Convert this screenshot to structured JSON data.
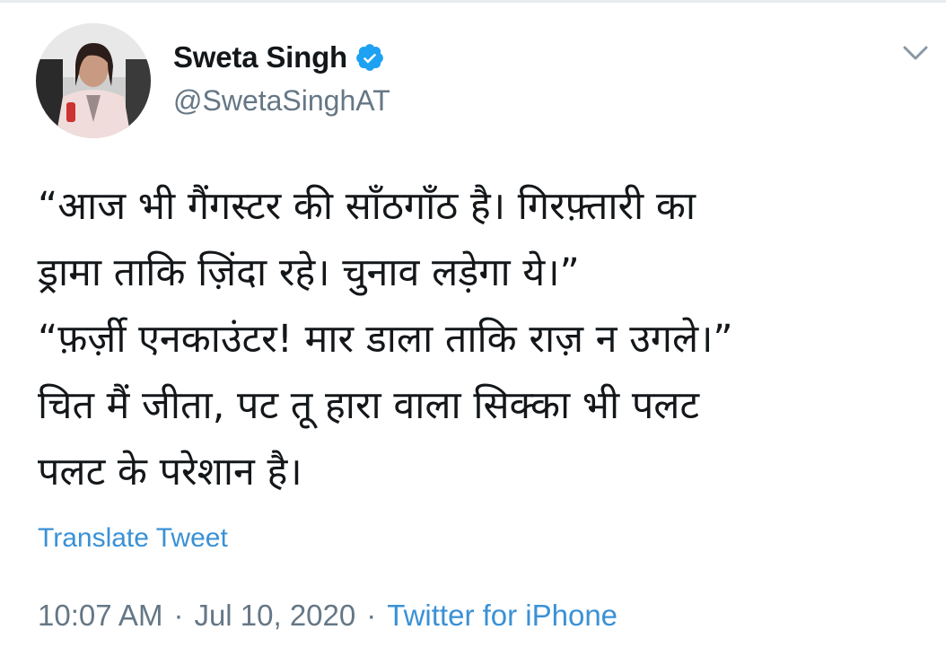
{
  "author": {
    "display_name": "Sweta Singh",
    "handle": "@SwetaSinghAT",
    "verified": true,
    "avatar_icon": "profile-photo"
  },
  "menu_icon": "chevron-down-icon",
  "tweet": {
    "lines": [
      "“आज भी गैंगस्टर की साँठगाँठ है। गिरफ़्तारी का",
      "ड्रामा ताकि ज़िंदा रहे। चुनाव लड़ेगा ये।”",
      "“फ़र्ज़ी एनकाउंटर! मार डाला ताकि राज़ न उगले।”",
      "चित मैं जीता, पट तू हारा वाला सिक्का भी पलट",
      "पलट के परेशान है।"
    ]
  },
  "translate_label": "Translate Tweet",
  "meta": {
    "time": "10:07 AM",
    "separator": "·",
    "date": "Jul 10, 2020",
    "source": "Twitter for iPhone"
  },
  "colors": {
    "link": "#3a91d6",
    "verified_badge": "#1da1f2",
    "secondary_text": "#657786",
    "primary_text": "#14171a"
  }
}
